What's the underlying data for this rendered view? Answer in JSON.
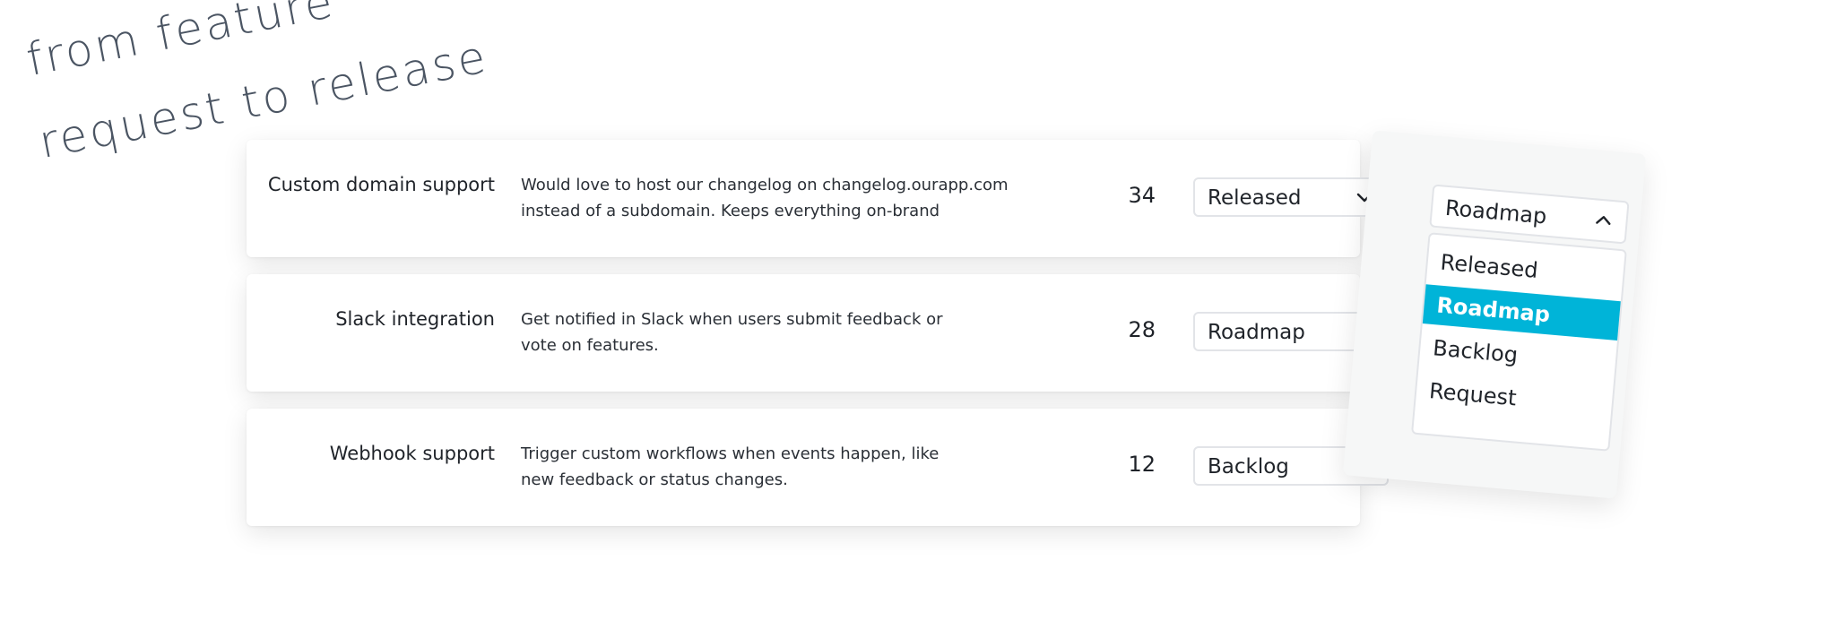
{
  "headline": {
    "line1": "from feature",
    "line2": "request to release"
  },
  "features": [
    {
      "title": "Custom domain support",
      "description": "Would love to host our changelog on changelog.ourapp.com instead of a subdomain. Keeps everything on-brand",
      "votes": "34",
      "status": "Released",
      "chevron": "chevron-down-icon"
    },
    {
      "title": "Slack integration",
      "description": "Get notified in Slack when users submit feedback or vote on features.",
      "votes": "28",
      "status": "Roadmap",
      "chevron": "chevron-down-icon"
    },
    {
      "title": "Webhook support",
      "description": "Trigger custom workflows when events happen, like new feedback or status changes.",
      "votes": "12",
      "status": "Backlog",
      "chevron": "chevron-up-icon"
    }
  ],
  "dropdown": {
    "selected": "Roadmap",
    "chevron": "chevron-up-icon",
    "options": [
      "Released",
      "Roadmap",
      "Backlog",
      "Request"
    ],
    "highlighted_option": "Roadmap"
  },
  "colors": {
    "highlight": "#00b4d8",
    "handwriting": "#4b5563",
    "text": "#1f2329"
  }
}
